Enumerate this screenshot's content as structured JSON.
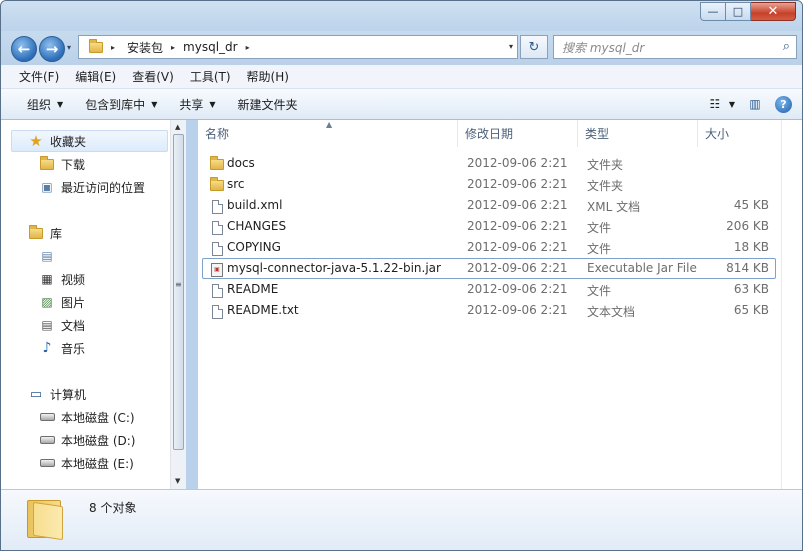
{
  "window": {
    "controls": {
      "minimize": "—",
      "maximize": "□",
      "close": "✕"
    }
  },
  "nav": {
    "back_icon": "←",
    "forward_icon": "→",
    "recent_icon": "▾",
    "breadcrumb": [
      "安装包",
      "mysql_dr"
    ],
    "refresh_icon": "↻",
    "search_placeholder": "搜索 mysql_dr",
    "search_icon": "⌕"
  },
  "menubar": [
    "文件(F)",
    "编辑(E)",
    "查看(V)",
    "工具(T)",
    "帮助(H)"
  ],
  "toolbar": {
    "organize": "组织",
    "include_in_library": "包含到库中",
    "share": "共享",
    "new_folder": "新建文件夹",
    "view_icon": "☷",
    "preview_icon": "▥",
    "help_icon": "?"
  },
  "sidebar": {
    "favorites": {
      "label": "收藏夹",
      "items": [
        "下载",
        "最近访问的位置"
      ]
    },
    "libraries": {
      "label": "库",
      "items": [
        "",
        "视频",
        "图片",
        "文档",
        "音乐"
      ]
    },
    "computer": {
      "label": "计算机",
      "items": [
        "本地磁盘 (C:)",
        "本地磁盘 (D:)",
        "本地磁盘 (E:)"
      ]
    }
  },
  "columns": {
    "name": "名称",
    "modified": "修改日期",
    "type": "类型",
    "size": "大小"
  },
  "files": [
    {
      "name": "docs",
      "modified": "2012-09-06 2:21",
      "type": "文件夹",
      "size": "",
      "kind": "folder"
    },
    {
      "name": "src",
      "modified": "2012-09-06 2:21",
      "type": "文件夹",
      "size": "",
      "kind": "folder"
    },
    {
      "name": "build.xml",
      "modified": "2012-09-06 2:21",
      "type": "XML 文档",
      "size": "45 KB",
      "kind": "file"
    },
    {
      "name": "CHANGES",
      "modified": "2012-09-06 2:21",
      "type": "文件",
      "size": "206 KB",
      "kind": "file"
    },
    {
      "name": "COPYING",
      "modified": "2012-09-06 2:21",
      "type": "文件",
      "size": "18 KB",
      "kind": "file"
    },
    {
      "name": "mysql-connector-java-5.1.22-bin.jar",
      "modified": "2012-09-06 2:21",
      "type": "Executable Jar File",
      "size": "814 KB",
      "kind": "jar"
    },
    {
      "name": "README",
      "modified": "2012-09-06 2:21",
      "type": "文件",
      "size": "63 KB",
      "kind": "file"
    },
    {
      "name": "README.txt",
      "modified": "2012-09-06 2:21",
      "type": "文本文档",
      "size": "65 KB",
      "kind": "file"
    }
  ],
  "selected_index": 5,
  "details": {
    "count_text": "8 个对象"
  }
}
